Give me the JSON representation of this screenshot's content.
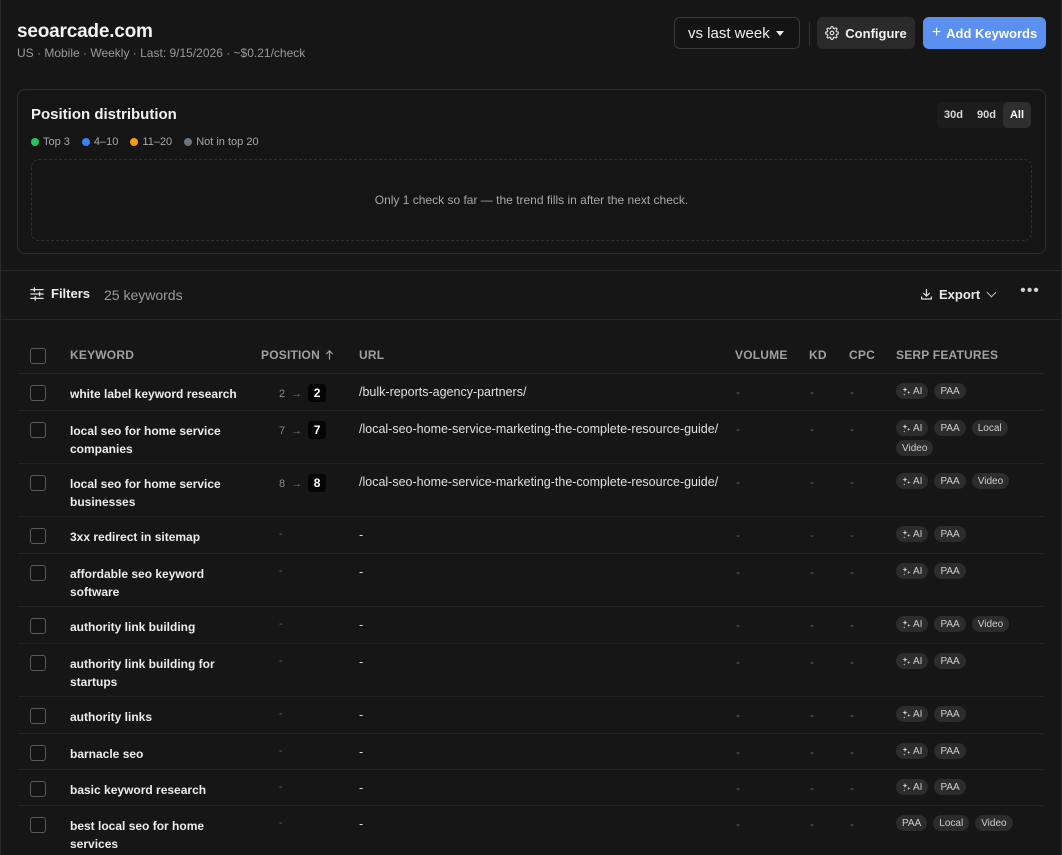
{
  "header": {
    "site": "seoarcade.com",
    "meta": "US · Mobile · Weekly · Last: 9/15/2026 · ~$0.21/check",
    "compare_value": "vs last week",
    "configure_label": "Configure",
    "add_keywords_label": "Add Keywords"
  },
  "distribution": {
    "title": "Position distribution",
    "ranges": [
      "30d",
      "90d",
      "All"
    ],
    "active_range": "All",
    "legend": [
      {
        "label": "Top 3",
        "color": "#22c55e"
      },
      {
        "label": "4–10",
        "color": "#3b82f6"
      },
      {
        "label": "11–20",
        "color": "#f59e0b"
      },
      {
        "label": "Not in top 20",
        "color": "#6b7280"
      }
    ],
    "empty_message": "Only 1 check so far — the trend fills in after the next check."
  },
  "toolbar": {
    "filters_label": "Filters",
    "keyword_count": "25 keywords",
    "export_label": "Export"
  },
  "table": {
    "columns": {
      "keyword": "Keyword",
      "position": "Position",
      "url": "URL",
      "volume": "Volume",
      "kd": "KD",
      "cpc": "CPC",
      "serp": "SERP Features"
    },
    "rows": [
      {
        "keyword": "white label keyword research",
        "prev": "2",
        "pos": "2",
        "url": "/bulk-reports-agency-partners/",
        "volume": "-",
        "kd": "-",
        "cpc": "-",
        "serp": [
          "AI",
          "PAA"
        ]
      },
      {
        "keyword": "local seo for home service companies",
        "prev": "7",
        "pos": "7",
        "url": "/local-seo-home-service-marketing-the-complete-resource-guide/",
        "volume": "-",
        "kd": "-",
        "cpc": "-",
        "serp": [
          "AI",
          "PAA",
          "Local",
          "Video"
        ]
      },
      {
        "keyword": "local seo for home service businesses",
        "prev": "8",
        "pos": "8",
        "url": "/local-seo-home-service-marketing-the-complete-resource-guide/",
        "volume": "-",
        "kd": "-",
        "cpc": "-",
        "serp": [
          "AI",
          "PAA",
          "Video"
        ]
      },
      {
        "keyword": "3xx redirect in sitemap",
        "prev": "",
        "pos": "-",
        "url": "-",
        "volume": "-",
        "kd": "-",
        "cpc": "-",
        "serp": [
          "AI",
          "PAA"
        ]
      },
      {
        "keyword": "affordable seo keyword software",
        "prev": "",
        "pos": "-",
        "url": "-",
        "volume": "-",
        "kd": "-",
        "cpc": "-",
        "serp": [
          "AI",
          "PAA"
        ]
      },
      {
        "keyword": "authority link building",
        "prev": "",
        "pos": "-",
        "url": "-",
        "volume": "-",
        "kd": "-",
        "cpc": "-",
        "serp": [
          "AI",
          "PAA",
          "Video"
        ]
      },
      {
        "keyword": "authority link building for startups",
        "prev": "",
        "pos": "-",
        "url": "-",
        "volume": "-",
        "kd": "-",
        "cpc": "-",
        "serp": [
          "AI",
          "PAA"
        ]
      },
      {
        "keyword": "authority links",
        "prev": "",
        "pos": "-",
        "url": "-",
        "volume": "-",
        "kd": "-",
        "cpc": "-",
        "serp": [
          "AI",
          "PAA"
        ]
      },
      {
        "keyword": "barnacle seo",
        "prev": "",
        "pos": "-",
        "url": "-",
        "volume": "-",
        "kd": "-",
        "cpc": "-",
        "serp": [
          "AI",
          "PAA"
        ]
      },
      {
        "keyword": "basic keyword research",
        "prev": "",
        "pos": "-",
        "url": "-",
        "volume": "-",
        "kd": "-",
        "cpc": "-",
        "serp": [
          "AI",
          "PAA"
        ]
      },
      {
        "keyword": "best local seo for home services",
        "prev": "",
        "pos": "-",
        "url": "-",
        "volume": "-",
        "kd": "-",
        "cpc": "-",
        "serp": [
          "PAA",
          "Local",
          "Video"
        ]
      }
    ]
  }
}
